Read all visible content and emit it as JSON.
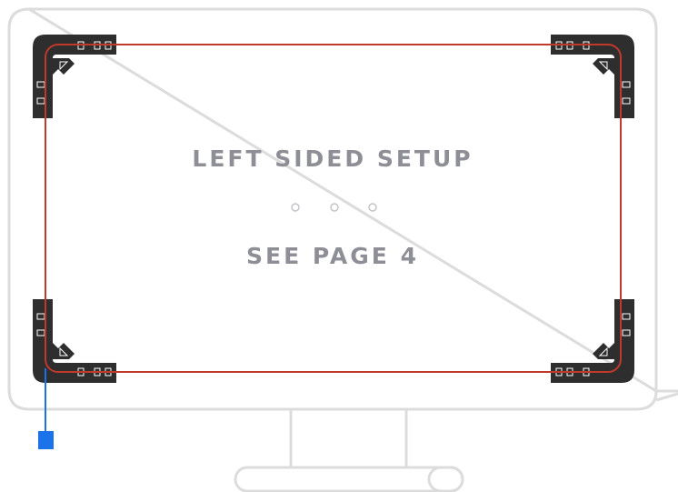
{
  "diagram": {
    "title": "LEFT SIDED SETUP",
    "subtitle": "SEE PAGE 4",
    "separator_dots": 3
  },
  "colors": {
    "outline": "#dcdcdc",
    "strip": "#c0392b",
    "mount": "#2e2e2e",
    "mount_detail": "#ffffff",
    "controller": "#1a73e8",
    "text": "#8e8e96"
  },
  "icons": {
    "corner_mount": "corner-mount-icon",
    "controller": "controller-box-icon"
  }
}
